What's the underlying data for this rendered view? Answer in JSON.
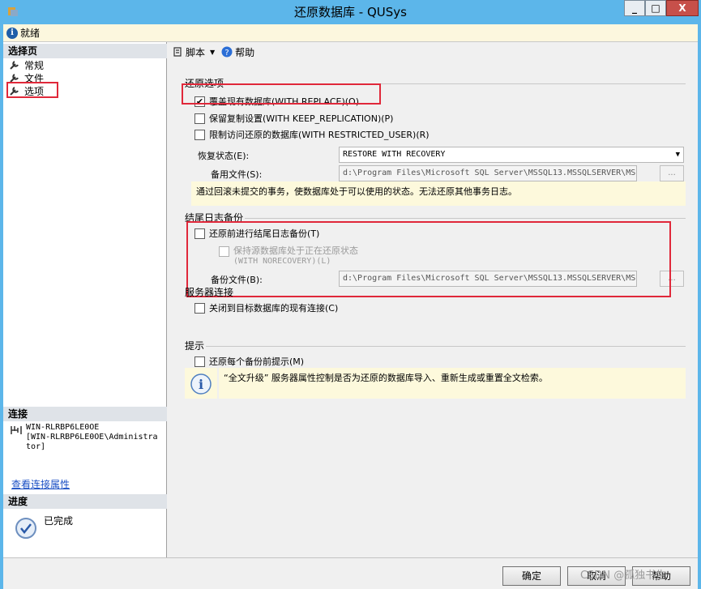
{
  "window": {
    "title": "还原数据库 - QUSys",
    "min_label": "_",
    "max_label": "□",
    "close_label": "X"
  },
  "status": {
    "text": "就绪",
    "icon": "info-icon"
  },
  "left": {
    "select_page_header": "选择页",
    "pages": [
      {
        "label": "常规",
        "icon": "wrench-icon"
      },
      {
        "label": "文件",
        "icon": "wrench-icon"
      },
      {
        "label": "选项",
        "icon": "wrench-icon",
        "selected": true
      }
    ],
    "connection_header": "连接",
    "connection_lines": [
      "WIN-RLRBP6LE0OE",
      "[WIN-RLRBP6LE0OE\\Administra",
      "tor]"
    ],
    "view_connection_link": "查看连接属性",
    "progress_header": "进度",
    "progress_status": "已完成"
  },
  "toolbar": {
    "script_label": "脚本",
    "help_label": "帮助"
  },
  "restore_options": {
    "title": "还原选项",
    "overwrite_label": "覆盖现有数据库(WITH REPLACE)(O)",
    "overwrite_checked": true,
    "keep_replication_label": "保留复制设置(WITH KEEP_REPLICATION)(P)",
    "keep_replication_checked": false,
    "restricted_user_label": "限制访问还原的数据库(WITH RESTRICTED_USER)(R)",
    "restricted_user_checked": false,
    "recovery_state_label": "恢复状态(E):",
    "recovery_state_value": "RESTORE WITH RECOVERY",
    "standby_file_label": "备用文件(S):",
    "standby_file_value": "d:\\Program Files\\Microsoft SQL Server\\MSSQL13.MSSQLSERVER\\MSS",
    "browse_label": "...",
    "recovery_notice": "通过回滚未提交的事务，使数据库处于可以使用的状态。无法还原其他事务日志。"
  },
  "tail_log": {
    "title": "结尾日志备份",
    "tail_backup_label": "还原前进行结尾日志备份(T)",
    "tail_backup_checked": false,
    "norecovery_label_1": "保持源数据库处于正在还原状态",
    "norecovery_label_2": "(WITH NORECOVERY)(L)",
    "backup_file_label": "备份文件(B):",
    "backup_file_value": "d:\\Program Files\\Microsoft SQL Server\\MSSQL13.MSSQLSERVER\\MSS",
    "browse_label": "..."
  },
  "server_connection": {
    "title": "服务器连接",
    "close_connections_label": "关闭到目标数据库的现有连接(C)",
    "close_connections_checked": false
  },
  "prompt": {
    "title": "提示",
    "prompt_each_label": "还原每个备份前提示(M)",
    "prompt_each_checked": false,
    "info_notice": "“全文升级” 服务器属性控制是否为还原的数据库导入、重新生成或重置全文检索。"
  },
  "buttons": {
    "ok": "确定",
    "cancel": "取消",
    "help": "帮助"
  },
  "watermark": "CSDN @孤独书生",
  "colors": {
    "titlebar": "#5cb6ea",
    "highlight_box": "#e0283a",
    "notice_bg": "#fdf9dc"
  }
}
